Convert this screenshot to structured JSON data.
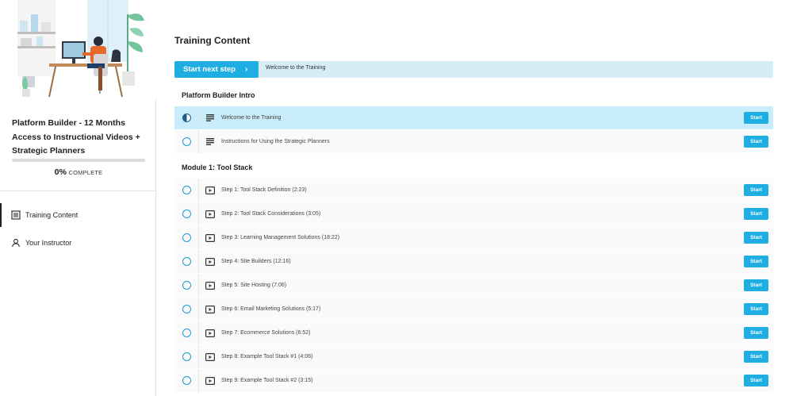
{
  "sidebar": {
    "course_title": "Platform Builder - 12 Months Access to Instructional Videos + Strategic Planners",
    "progress": {
      "percent": 0,
      "percent_text": "0%",
      "label": "COMPLETE"
    },
    "nav": [
      {
        "label": "Training Content",
        "icon": "list-icon",
        "active": true
      },
      {
        "label": "Your Instructor",
        "icon": "person-icon",
        "active": false
      }
    ]
  },
  "main": {
    "title": "Training Content",
    "next_step": {
      "button_label": "Start next step",
      "chevron": "›",
      "lesson": "Welcome to the Training"
    },
    "sections": [
      {
        "title": "Platform Builder Intro",
        "lessons": [
          {
            "label": "Welcome to the Training",
            "type": "text",
            "status": "in-progress",
            "action": "Start"
          },
          {
            "label": "Instructions for Using the Strategic Planners",
            "type": "text",
            "status": "not-started",
            "action": "Start"
          }
        ]
      },
      {
        "title": "Module 1: Tool Stack",
        "lessons": [
          {
            "label": "Step 1: Tool Stack Definition (2:23)",
            "type": "video",
            "status": "not-started",
            "action": "Start"
          },
          {
            "label": "Step 2: Tool Stack Considerations (3:05)",
            "type": "video",
            "status": "not-started",
            "action": "Start"
          },
          {
            "label": "Step 3: Learning Management Solutions (18:22)",
            "type": "video",
            "status": "not-started",
            "action": "Start"
          },
          {
            "label": "Step 4: Site Builders (12:16)",
            "type": "video",
            "status": "not-started",
            "action": "Start"
          },
          {
            "label": "Step 5: Site Hosting (7:06)",
            "type": "video",
            "status": "not-started",
            "action": "Start"
          },
          {
            "label": "Step 6: Email Marketing Solutions (5:17)",
            "type": "video",
            "status": "not-started",
            "action": "Start"
          },
          {
            "label": "Step 7: Ecommerce Solutions (6:52)",
            "type": "video",
            "status": "not-started",
            "action": "Start"
          },
          {
            "label": "Step 8: Example Tool Stack #1 (4:06)",
            "type": "video",
            "status": "not-started",
            "action": "Start"
          },
          {
            "label": "Step 9: Example Tool Stack #2 (3:15)",
            "type": "video",
            "status": "not-started",
            "action": "Start"
          }
        ]
      }
    ]
  },
  "colors": {
    "accent": "#1eaee2",
    "current_row": "#c8ecf9",
    "next_bar": "#d7edf5"
  }
}
